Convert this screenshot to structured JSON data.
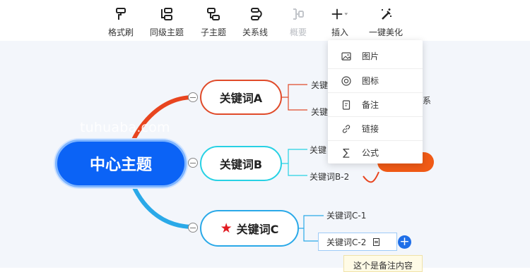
{
  "toolbar": {
    "items": [
      {
        "label": "格式刷",
        "icon": "format-painter-icon",
        "enabled": true
      },
      {
        "label": "同级主题",
        "icon": "sibling-topic-icon",
        "enabled": true
      },
      {
        "label": "子主题",
        "icon": "subtopic-icon",
        "enabled": true
      },
      {
        "label": "关系线",
        "icon": "relation-line-icon",
        "enabled": true
      },
      {
        "label": "概要",
        "icon": "summary-icon",
        "enabled": false
      },
      {
        "label": "插入",
        "icon": "plus-icon",
        "enabled": true
      },
      {
        "label": "一键美化",
        "icon": "magic-wand-icon",
        "enabled": true
      }
    ]
  },
  "insert_menu": {
    "items": [
      {
        "label": "图片",
        "icon": "image-icon"
      },
      {
        "label": "图标",
        "icon": "target-icon"
      },
      {
        "label": "备注",
        "icon": "note-icon"
      },
      {
        "label": "链接",
        "icon": "link-icon"
      },
      {
        "label": "公式",
        "icon": "sigma-icon"
      }
    ]
  },
  "mindmap": {
    "center": "中心主题",
    "branches": [
      {
        "label": "关键词A",
        "color": "#e04b2a",
        "children": [
          "关键",
          "关键"
        ]
      },
      {
        "label": "关键词B",
        "color": "#27d1e4",
        "children": [
          "关键",
          "关键词B-2"
        ]
      },
      {
        "label": "关键词C",
        "color": "#2aa9e8",
        "children": [
          "关键词C-1",
          "关键词C-2"
        ]
      }
    ],
    "hidden_fragment": "系",
    "note_tooltip": "这个是备注内容"
  },
  "watermark": "tuhuaba.com",
  "colors": {
    "center": "#0b63f6",
    "accent": "#1f6fe8",
    "star": "#e11b22",
    "relation_pill": "#f05a16"
  }
}
